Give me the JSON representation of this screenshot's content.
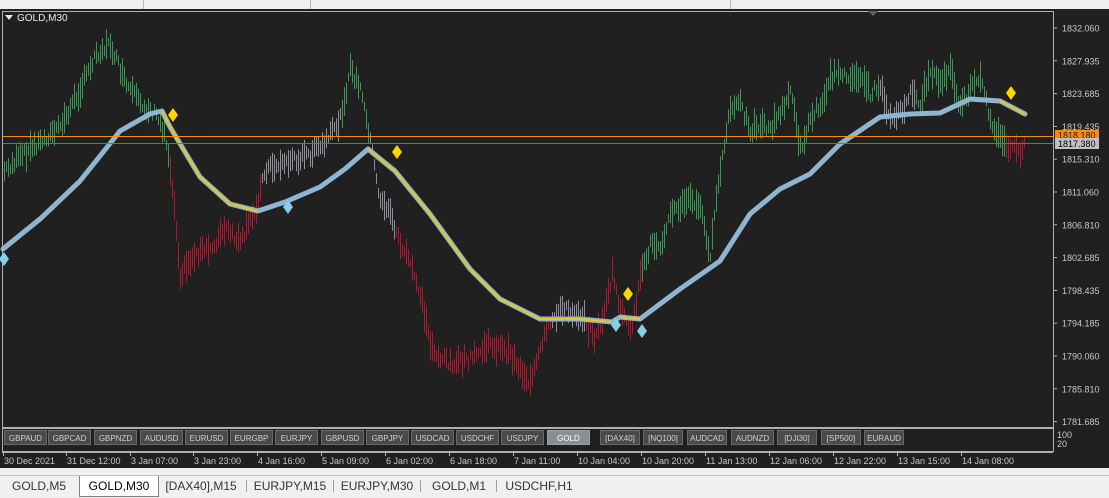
{
  "window": {
    "symbol_label": "GOLD,M30"
  },
  "price_axis": {
    "labels": [
      "1832.060",
      "1827.935",
      "1823.685",
      "1819.435",
      "1815.310",
      "1811.060",
      "1806.810",
      "1802.685",
      "1798.435",
      "1794.185",
      "1790.060",
      "1785.810",
      "1781.685"
    ],
    "orange_line_label": "1818.180",
    "current_price_label": "1817.380",
    "colors": {
      "orange_line": "#ff8c00",
      "current_price_bg": "#c0c0c0"
    }
  },
  "indicator_scale": {
    "top": "100",
    "bottom": "20"
  },
  "time_axis": {
    "labels": [
      "30 Dec 2021",
      "31 Dec 12:00",
      "3 Jan 07:00",
      "3 Jan 23:00",
      "4 Jan 16:00",
      "5 Jan 09:00",
      "6 Jan 02:00",
      "6 Jan 18:00",
      "7 Jan 11:00",
      "10 Jan 04:00",
      "10 Jan 20:00",
      "11 Jan 13:00",
      "12 Jan 06:00",
      "12 Jan 22:00",
      "13 Jan 15:00",
      "14 Jan 08:00"
    ]
  },
  "symbol_buttons": [
    {
      "label": "GBPAUD",
      "active": false
    },
    {
      "label": "GBPCAD",
      "active": false
    },
    {
      "label": "GBPNZD",
      "active": false
    },
    {
      "label": "AUDUSD",
      "active": false
    },
    {
      "label": "EURUSD",
      "active": false
    },
    {
      "label": "EURGBP",
      "active": false
    },
    {
      "label": "EURJPY",
      "active": false
    },
    {
      "label": "GBPUSD",
      "active": false
    },
    {
      "label": "GBPJPY",
      "active": false
    },
    {
      "label": "USDCAD",
      "active": false
    },
    {
      "label": "USDCHF",
      "active": false
    },
    {
      "label": "USDJPY",
      "active": false
    },
    {
      "label": "GOLD",
      "active": true
    },
    {
      "label": "[DAX40]",
      "active": false
    },
    {
      "label": "[NQ100]",
      "active": false
    },
    {
      "label": "AUDCAD",
      "active": false
    },
    {
      "label": "AUDNZD",
      "active": false
    },
    {
      "label": "[DJI30]",
      "active": false
    },
    {
      "label": "[SP500]",
      "active": false
    },
    {
      "label": "EURAUD",
      "active": false
    }
  ],
  "tabs": [
    {
      "label": "GOLD,M5",
      "active": false
    },
    {
      "label": "GOLD,M30",
      "active": true
    },
    {
      "label": "[DAX40],M15",
      "active": false
    },
    {
      "label": "EURJPY,M15",
      "active": false
    },
    {
      "label": "EURJPY,M30",
      "active": false
    },
    {
      "label": "GOLD,M1",
      "active": false
    },
    {
      "label": "USDCHF,H1",
      "active": false
    }
  ],
  "colors": {
    "background": "#202020",
    "bull_bar": "#3a9a55",
    "bear_bar": "#b01830",
    "neutral_bar": "#8f8f9b",
    "moving_average": "#8fb5d0",
    "moving_average_falling": "#e8c81a",
    "sell_signal": "#ffd700",
    "buy_signal": "#87ceeb"
  }
}
